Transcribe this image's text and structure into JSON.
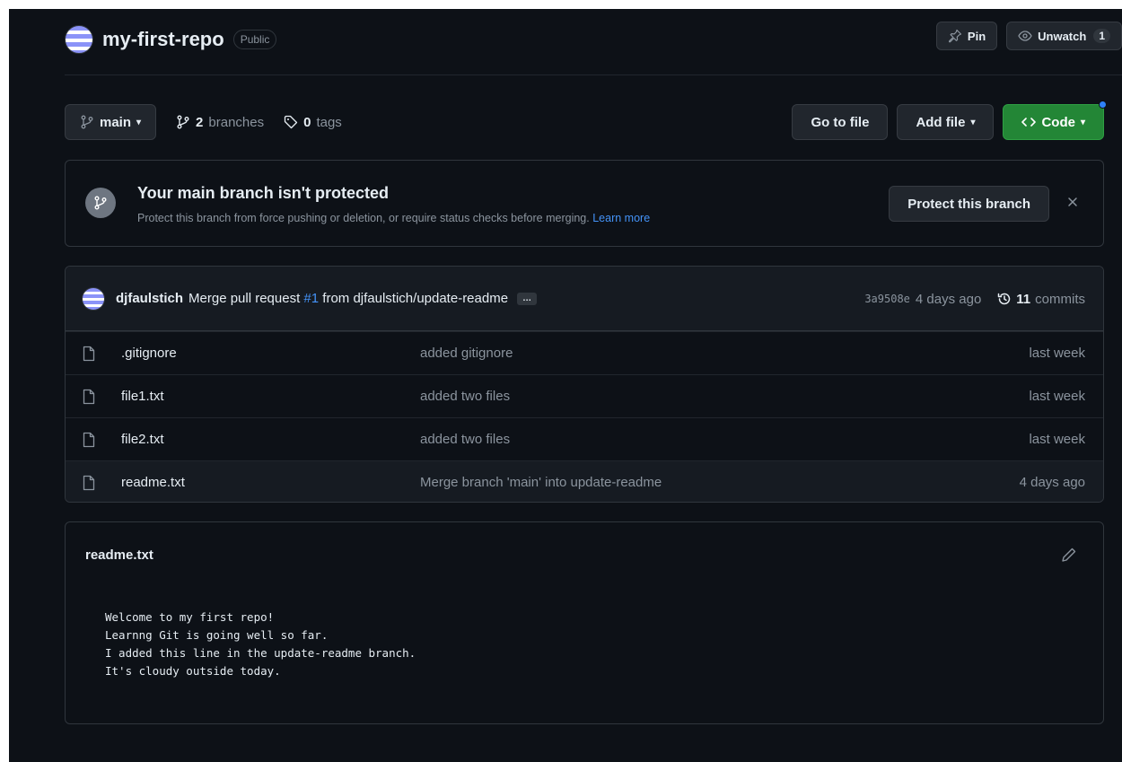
{
  "repo": {
    "name": "my-first-repo",
    "visibility": "Public",
    "pin_label": "Pin",
    "unwatch_label": "Unwatch",
    "watch_count": "1"
  },
  "branch_bar": {
    "current_branch": "main",
    "branch_count": "2",
    "branch_word": "branches",
    "tag_count": "0",
    "tag_word": "tags",
    "go_to_file": "Go to file",
    "add_file": "Add file",
    "code": "Code"
  },
  "banner": {
    "title": "Your main branch isn't protected",
    "description": "Protect this branch from force pushing or deletion, or require status checks before merging.",
    "learn_more": "Learn more",
    "protect_button": "Protect this branch"
  },
  "latest_commit": {
    "author": "djfaulstich",
    "message_prefix": "Merge pull request",
    "pr_number": "#1",
    "message_suffix": "from djfaulstich/update-readme",
    "ellipsis": "…",
    "sha": "3a9508e",
    "age": "4 days ago",
    "commit_count": "11",
    "commit_word": "commits"
  },
  "files": [
    {
      "name": ".gitignore",
      "commit": "added gitignore",
      "age": "last week"
    },
    {
      "name": "file1.txt",
      "commit": "added two files",
      "age": "last week"
    },
    {
      "name": "file2.txt",
      "commit": "added two files",
      "age": "last week"
    },
    {
      "name": "readme.txt",
      "commit": "Merge branch 'main' into update-readme",
      "age": "4 days ago"
    }
  ],
  "readme": {
    "title": "readme.txt",
    "lines": [
      "Welcome to my first repo!",
      "Learnng Git is going well so far.",
      "I added this line in the update-readme branch.",
      "It's cloudy outside today."
    ]
  },
  "colors": {
    "background": "#0d1117",
    "border": "#30363d",
    "green": "#238636",
    "link": "#4493f8"
  }
}
